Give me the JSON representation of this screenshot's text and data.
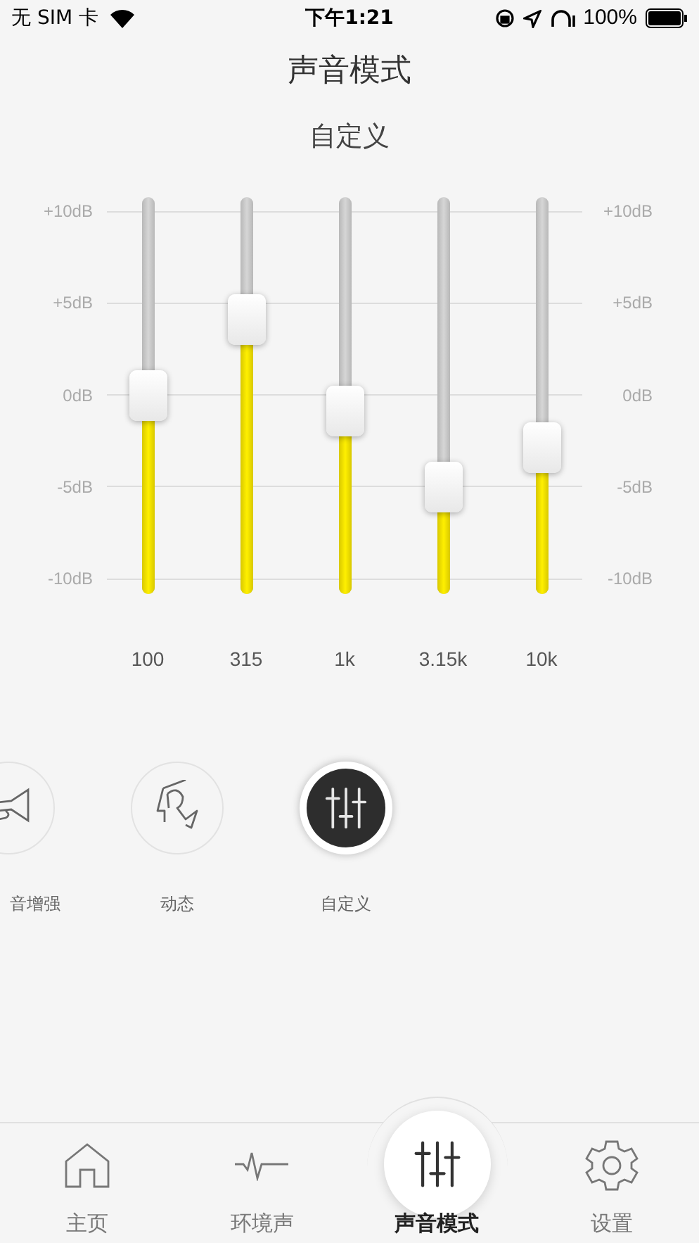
{
  "status_bar": {
    "carrier": "无 SIM 卡",
    "time": "下午1:21",
    "battery": "100%"
  },
  "title": "声音模式",
  "mode_name": "自定义",
  "equalizer": {
    "scale_left": [
      "+10dB",
      "+5dB",
      "0dB",
      "-5dB",
      "-10dB"
    ],
    "scale_right": [
      "+10dB",
      "+5dB",
      "0dB",
      "-5dB",
      "-10dB"
    ],
    "bands": [
      {
        "label": "100",
        "level": 0.5
      },
      {
        "label": "315",
        "level": 0.69
      },
      {
        "label": "1k",
        "level": 0.46
      },
      {
        "label": "3.15k",
        "level": 0.27
      },
      {
        "label": "10k",
        "level": 0.37
      }
    ]
  },
  "presets": [
    {
      "kind": "trumpet",
      "label": "音增强",
      "selected": false
    },
    {
      "kind": "dynamic",
      "label": "动态",
      "selected": false
    },
    {
      "kind": "custom",
      "label": "自定义",
      "selected": true
    }
  ],
  "tabs": [
    {
      "kind": "home",
      "label": "主页",
      "selected": false
    },
    {
      "kind": "ambient",
      "label": "环境声",
      "selected": false
    },
    {
      "kind": "sound",
      "label": "声音模式",
      "selected": true
    },
    {
      "kind": "settings",
      "label": "设置",
      "selected": false
    }
  ]
}
